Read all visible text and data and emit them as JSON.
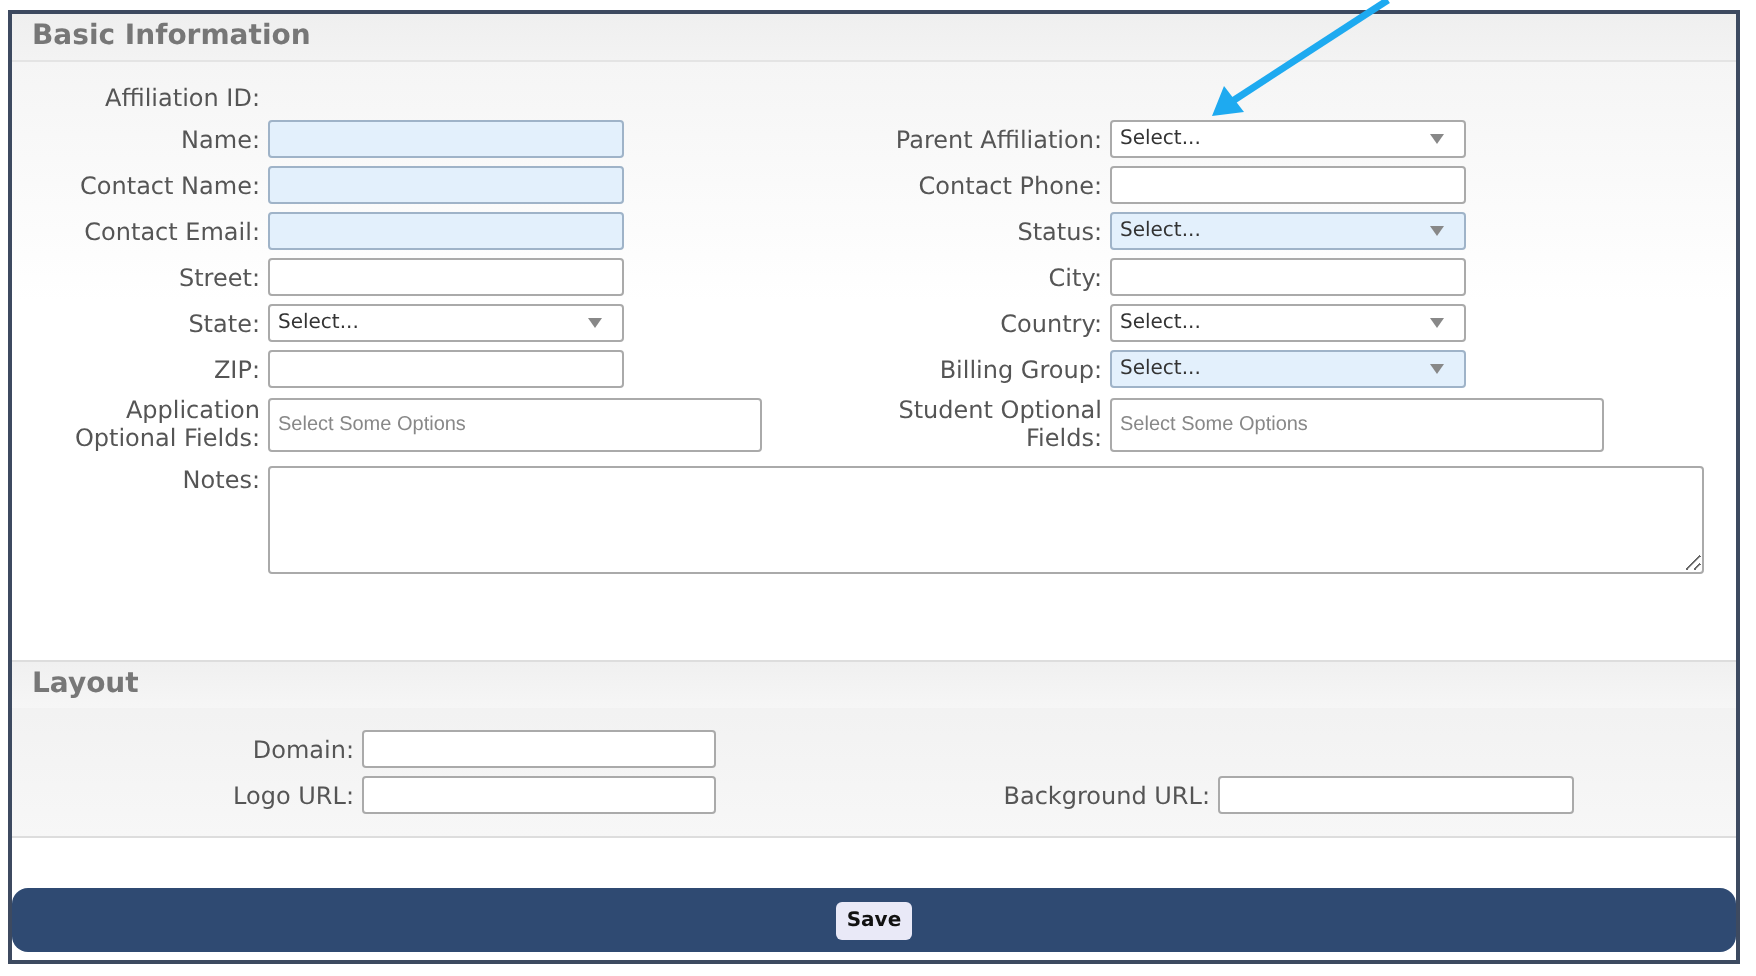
{
  "basic_information": {
    "title": "Basic Information",
    "rows": [
      {
        "cells": [
          {
            "label": "Affiliation ID:",
            "kind": "label_only"
          }
        ]
      },
      {
        "cells": [
          {
            "label": "Name:",
            "kind": "text",
            "required": true
          },
          {
            "label": "Parent Affiliation:",
            "kind": "select",
            "required": false,
            "value": "Select..."
          }
        ]
      },
      {
        "cells": [
          {
            "label": "Contact Name:",
            "kind": "text",
            "required": true
          },
          {
            "label": "Contact Phone:",
            "kind": "text",
            "required": false
          }
        ]
      },
      {
        "cells": [
          {
            "label": "Contact Email:",
            "kind": "text",
            "required": true
          },
          {
            "label": "Status:",
            "kind": "select",
            "required": true,
            "value": "Select..."
          }
        ]
      },
      {
        "cells": [
          {
            "label": "Street:",
            "kind": "text",
            "required": false
          },
          {
            "label": "City:",
            "kind": "text",
            "required": false
          }
        ]
      },
      {
        "cells": [
          {
            "label": "State:",
            "kind": "select",
            "required": false,
            "value": "Select..."
          },
          {
            "label": "Country:",
            "kind": "select",
            "required": false,
            "value": "Select..."
          }
        ]
      },
      {
        "cells": [
          {
            "label": "ZIP:",
            "kind": "text",
            "required": false
          },
          {
            "label": "Billing Group:",
            "kind": "select",
            "required": true,
            "value": "Select..."
          }
        ]
      }
    ],
    "optional_fields": [
      {
        "label": "Application Optional Fields:",
        "placeholder": "Select Some Options"
      },
      {
        "label": "Student Optional Fields:",
        "placeholder": "Select Some Options"
      }
    ],
    "notes": {
      "label": "Notes:"
    }
  },
  "layout": {
    "title": "Layout",
    "rows": [
      {
        "cells": [
          {
            "label": "Domain:",
            "kind": "text",
            "required": false
          }
        ]
      },
      {
        "cells": [
          {
            "label": "Logo URL:",
            "kind": "text",
            "required": false
          },
          {
            "label": "Background URL:",
            "kind": "text",
            "required": false
          }
        ]
      }
    ]
  },
  "footer": {
    "save_button": "Save"
  }
}
